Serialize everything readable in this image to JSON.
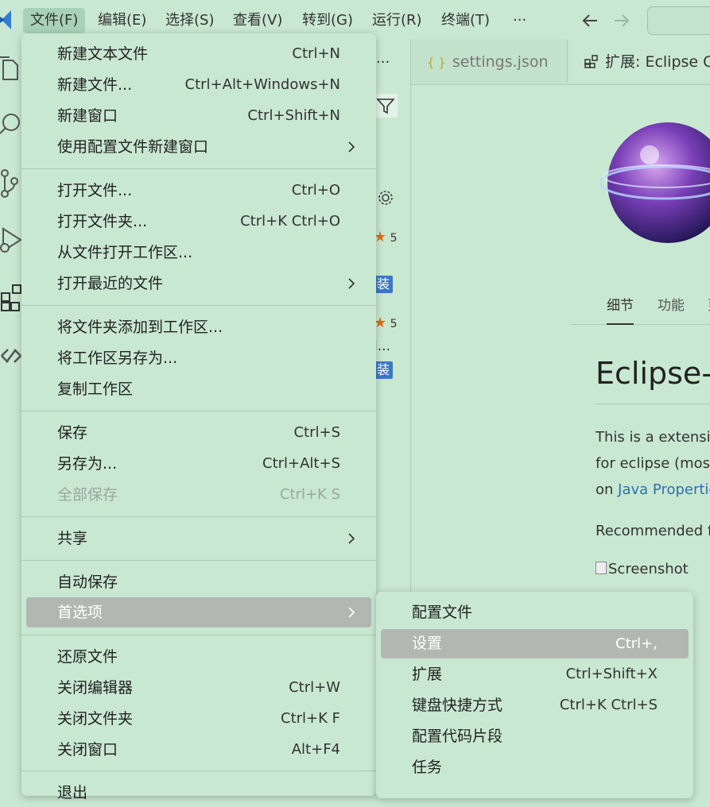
{
  "menubar": {
    "items": [
      "文件(F)",
      "编辑(E)",
      "选择(S)",
      "查看(V)",
      "转到(G)",
      "运行(R)",
      "终端(T)",
      "···"
    ]
  },
  "sidebar": {
    "more": "···",
    "rating1": "5",
    "install1": "装",
    "rating2": "5",
    "ellipsis": "l...",
    "install2": "装"
  },
  "tabs": {
    "settings": "settings.json",
    "settings_icon": "{ }",
    "extension": "扩展: Eclipse Co"
  },
  "extension": {
    "detail_tabs": [
      "细节",
      "功能",
      "更"
    ],
    "title": "Eclipse-I",
    "desc_line1": "This is a extensio",
    "desc_line2": "for eclipse (most",
    "desc_line3_prefix": "on ",
    "desc_line3_link": "Java Propertie",
    "recommended": "Recommended fo",
    "screenshot_alt": "Screenshot"
  },
  "file_menu": {
    "items": [
      {
        "label": "新建文本文件",
        "shortcut": "Ctrl+N"
      },
      {
        "label": "新建文件...",
        "shortcut": "Ctrl+Alt+Windows+N"
      },
      {
        "label": "新建窗口",
        "shortcut": "Ctrl+Shift+N"
      },
      {
        "label": "使用配置文件新建窗口",
        "shortcut": ""
      },
      {
        "label": "打开文件...",
        "shortcut": "Ctrl+O"
      },
      {
        "label": "打开文件夹...",
        "shortcut": "Ctrl+K Ctrl+O"
      },
      {
        "label": "从文件打开工作区...",
        "shortcut": ""
      },
      {
        "label": "打开最近的文件",
        "shortcut": ""
      },
      {
        "label": "将文件夹添加到工作区...",
        "shortcut": ""
      },
      {
        "label": "将工作区另存为...",
        "shortcut": ""
      },
      {
        "label": "复制工作区",
        "shortcut": ""
      },
      {
        "label": "保存",
        "shortcut": "Ctrl+S"
      },
      {
        "label": "另存为...",
        "shortcut": "Ctrl+Alt+S"
      },
      {
        "label": "全部保存",
        "shortcut": "Ctrl+K S"
      },
      {
        "label": "共享",
        "shortcut": ""
      },
      {
        "label": "自动保存",
        "shortcut": ""
      },
      {
        "label": "首选项",
        "shortcut": ""
      },
      {
        "label": "还原文件",
        "shortcut": ""
      },
      {
        "label": "关闭编辑器",
        "shortcut": "Ctrl+W"
      },
      {
        "label": "关闭文件夹",
        "shortcut": "Ctrl+K F"
      },
      {
        "label": "关闭窗口",
        "shortcut": "Alt+F4"
      },
      {
        "label": "退出",
        "shortcut": ""
      }
    ]
  },
  "preferences_submenu": {
    "items": [
      {
        "label": "配置文件",
        "shortcut": ""
      },
      {
        "label": "设置",
        "shortcut": "Ctrl+,"
      },
      {
        "label": "扩展",
        "shortcut": "Ctrl+Shift+X"
      },
      {
        "label": "键盘快捷方式",
        "shortcut": "Ctrl+K Ctrl+S"
      },
      {
        "label": "配置代码片段",
        "shortcut": ""
      },
      {
        "label": "任务",
        "shortcut": ""
      }
    ]
  },
  "colors": {
    "theme_background": "#c9e8d1",
    "highlight": "#b2b7b3",
    "link": "#2f6fb3",
    "install_badge": "#3b79c6",
    "star": "#e06b1a"
  },
  "icons": [
    "vscode-logo-icon",
    "explorer-icon",
    "search-icon",
    "source-control-icon",
    "run-debug-icon",
    "extensions-icon",
    "remote-icon",
    "back-arrow-icon",
    "forward-arrow-icon",
    "filter-icon",
    "gear-icon",
    "star-icon",
    "json-file-icon",
    "extension-tab-icon",
    "submenu-arrow-icon"
  ]
}
